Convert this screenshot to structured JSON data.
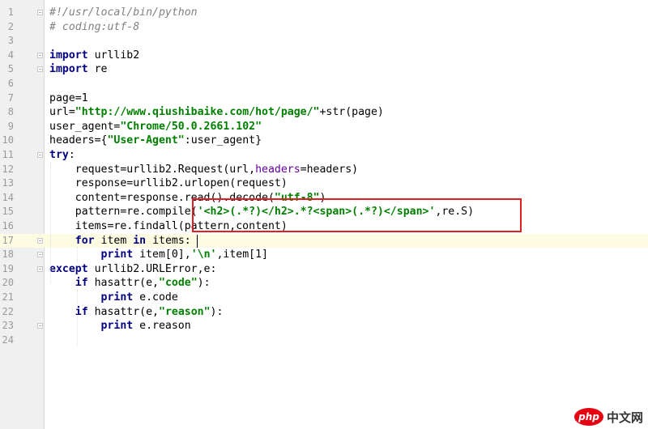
{
  "editor": {
    "lines": [
      {
        "n": "1"
      },
      {
        "n": "2"
      },
      {
        "n": "3"
      },
      {
        "n": "4"
      },
      {
        "n": "5"
      },
      {
        "n": "6"
      },
      {
        "n": "7"
      },
      {
        "n": "8"
      },
      {
        "n": "9"
      },
      {
        "n": "10"
      },
      {
        "n": "11"
      },
      {
        "n": "12"
      },
      {
        "n": "13"
      },
      {
        "n": "14"
      },
      {
        "n": "15"
      },
      {
        "n": "16"
      },
      {
        "n": "17"
      },
      {
        "n": "18"
      },
      {
        "n": "19"
      },
      {
        "n": "20"
      },
      {
        "n": "21"
      },
      {
        "n": "22"
      },
      {
        "n": "23"
      },
      {
        "n": "24"
      }
    ],
    "code": {
      "l1": "#!/usr/local/bin/python",
      "l2": "# coding:utf-8",
      "l4_kw": "import",
      "l4_rest": " urllib2",
      "l5_kw": "import",
      "l5_rest": " re",
      "l7": "page=1",
      "l8_a": "url=",
      "l8_s": "\"http://www.qiushibaike.com/hot/page/\"",
      "l8_b": "+str(page)",
      "l9_a": "user_agent=",
      "l9_s": "\"Chrome/50.0.2661.102\"",
      "l10_a": "headers={",
      "l10_s": "\"User-Agent\"",
      "l10_b": ":user_agent}",
      "l11_kw": "try",
      "l11_b": ":",
      "l12_a": "    request=urllib2.Request(url,",
      "l12_k": "headers",
      "l12_b": "=headers)",
      "l13": "    response=urllib2.urlopen(request)",
      "l14_a": "    content=response.read().decode(",
      "l14_s": "\"utf-8\"",
      "l14_b": ")",
      "l15_a": "    pattern=re.compile(",
      "l15_s": "'<h2>(.*?)</h2>.*?<span>(.*?)</span>'",
      "l15_b": ",re.S)",
      "l16": "    items=re.findall(pattern,content)",
      "l17_a": "    ",
      "l17_kw1": "for",
      "l17_b": " item ",
      "l17_kw2": "in",
      "l17_c": " items:",
      "l18_a": "        ",
      "l18_kw": "print",
      "l18_b": " item[0],",
      "l18_s": "'\\n'",
      "l18_c": ",item[1]",
      "l19_kw": "except",
      "l19_b": " urllib2.URLError,e:",
      "l20_a": "    ",
      "l20_kw": "if",
      "l20_b": " hasattr(e,",
      "l20_s": "\"code\"",
      "l20_c": "):",
      "l21_a": "        ",
      "l21_kw": "print",
      "l21_b": " e.code",
      "l22_a": "    ",
      "l22_kw": "if",
      "l22_b": " hasattr(e,",
      "l22_s": "\"reason\"",
      "l22_c": "):",
      "l23_a": "        ",
      "l23_kw": "print",
      "l23_b": " e.reason"
    },
    "current_line": "17"
  },
  "watermark": {
    "logo": "php",
    "text": "中文网"
  },
  "colors": {
    "keyword": "#000080",
    "string": "#008000",
    "comment": "#808080",
    "highlight_box": "#e02020"
  }
}
